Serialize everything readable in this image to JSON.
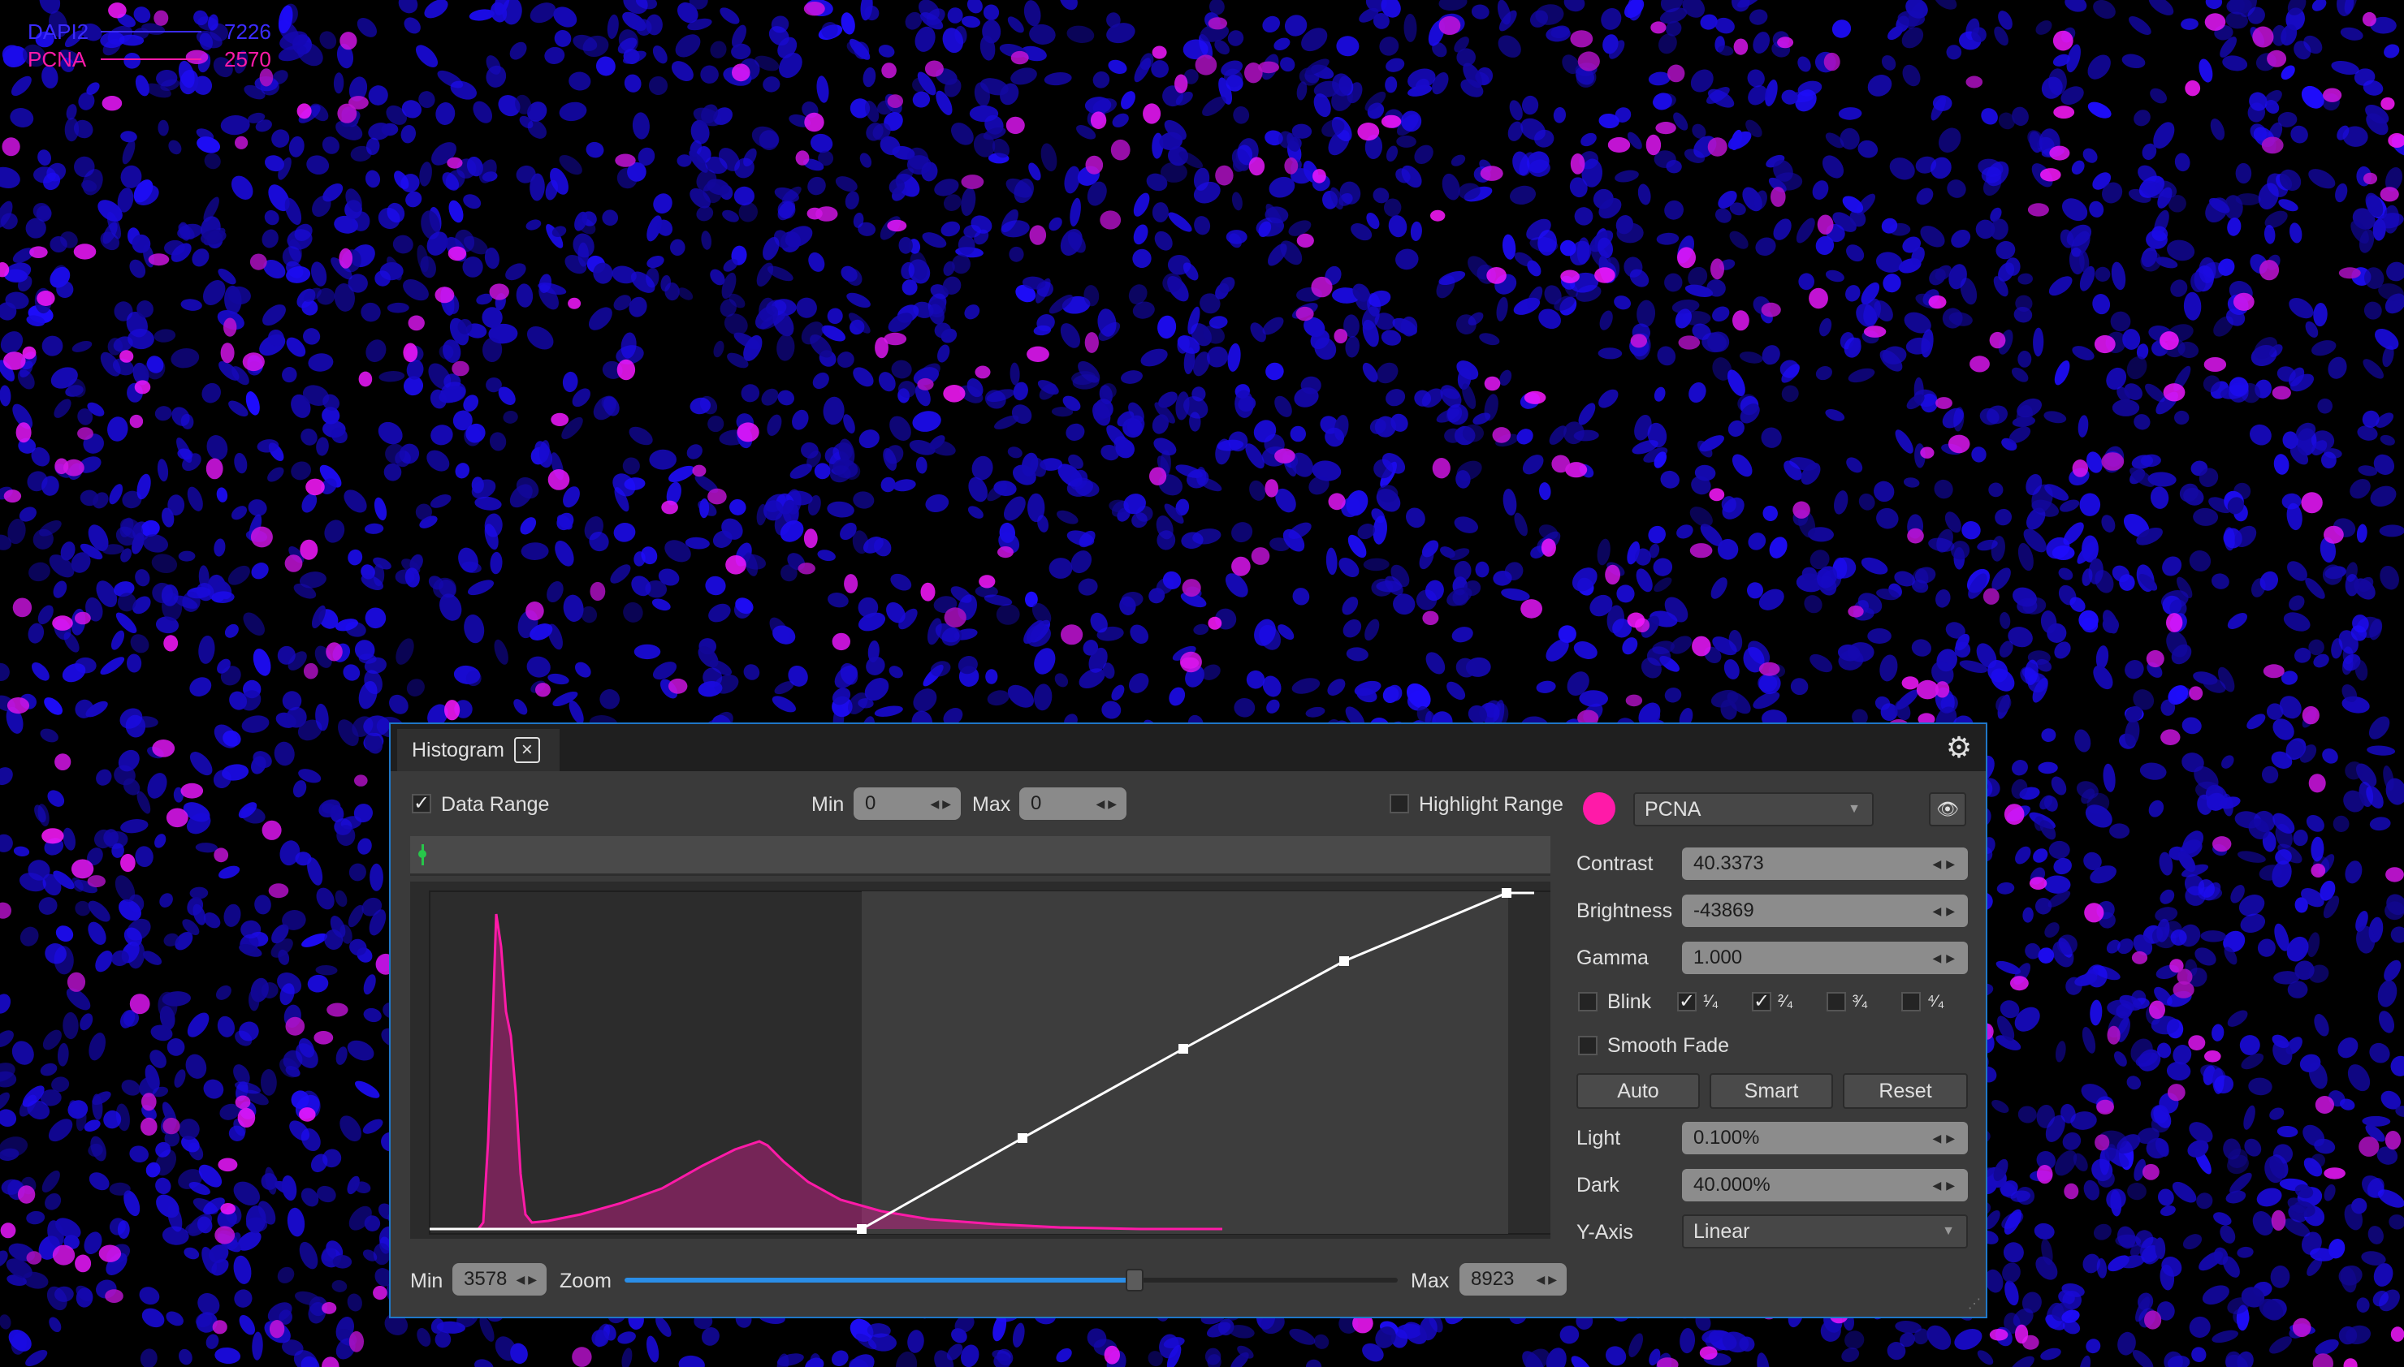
{
  "legend": [
    {
      "name": "DAPI2",
      "value": "7226",
      "color": "#3b2bff"
    },
    {
      "name": "PCNA",
      "value": "2570",
      "color": "#ff1aa8"
    }
  ],
  "histogram": {
    "tab_label": "Histogram",
    "close_icon": "close-icon",
    "settings_icon": "gear-icon",
    "data_range": {
      "label": "Data Range",
      "checked": true
    },
    "top_min": {
      "label": "Min",
      "value": "0"
    },
    "top_max": {
      "label": "Max",
      "value": "0"
    },
    "highlight_range": {
      "label": "Highlight Range",
      "checked": false
    },
    "bottom_min": {
      "label": "Min",
      "value": "3578"
    },
    "zoom": {
      "label": "Zoom",
      "level": 0.66
    },
    "bottom_max": {
      "label": "Max",
      "value": "8923"
    },
    "range_indicator_color": "#27c64a"
  },
  "controls": {
    "channel_color": "#ff1aa8",
    "channel": "PCNA",
    "visibility_icon": "eye-icon",
    "contrast": {
      "label": "Contrast",
      "value": "40.3373"
    },
    "brightness": {
      "label": "Brightness",
      "value": "-43869"
    },
    "gamma": {
      "label": "Gamma",
      "value": "1.000"
    },
    "blink": {
      "label": "Blink",
      "checked": false
    },
    "quarters": [
      {
        "label": "¹⁄₄",
        "checked": true
      },
      {
        "label": "²⁄₄",
        "checked": true
      },
      {
        "label": "³⁄₄",
        "checked": false
      },
      {
        "label": "⁴⁄₄",
        "checked": false
      }
    ],
    "smooth_fade": {
      "label": "Smooth Fade",
      "checked": false
    },
    "auto": "Auto",
    "smart": "Smart",
    "reset": "Reset",
    "light": {
      "label": "Light",
      "value": "0.100%"
    },
    "dark": {
      "label": "Dark",
      "value": "40.000%"
    },
    "yaxis": {
      "label": "Y-Axis",
      "value": "Linear"
    }
  },
  "colors": {
    "panel_border": "#1f77c8",
    "histogram_curve": "#ff1aa8",
    "zoom_fill": "#2a8ee8"
  }
}
